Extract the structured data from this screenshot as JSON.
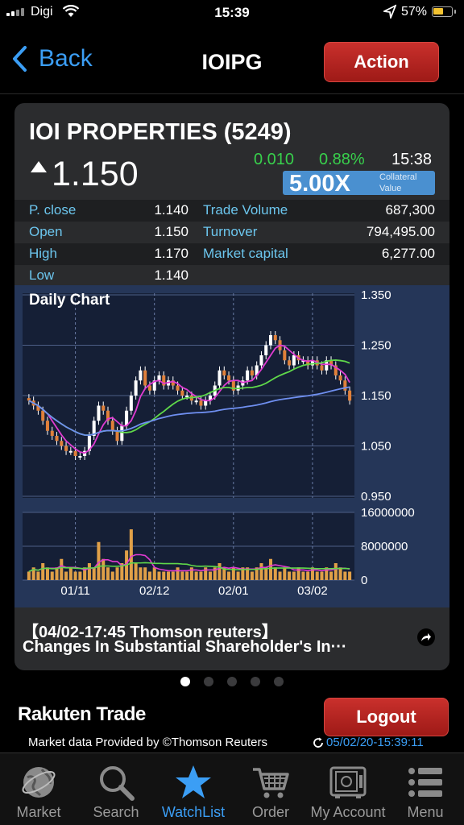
{
  "status": {
    "carrier": "Digi",
    "time": "15:39",
    "battery": "57%"
  },
  "nav": {
    "back_label": "Back",
    "title": "IOIPG",
    "action_label": "Action"
  },
  "stock": {
    "name": "IOI PROPERTIES (5249)",
    "price": "1.150",
    "change": "0.010",
    "change_pct": "0.88%",
    "time": "15:38",
    "collateral_multiplier": "5.00X",
    "collateral_label_1": "Collateral",
    "collateral_label_2": "Value",
    "up_color": "#38d04c"
  },
  "quote": {
    "rows": [
      {
        "l1": "P. close",
        "v1": "1.140",
        "l2": "Trade Volume",
        "v2": "687,300"
      },
      {
        "l1": "Open",
        "v1": "1.150",
        "l2": "Turnover",
        "v2": "794,495.00"
      },
      {
        "l1": "High",
        "v1": "1.170",
        "l2": "Market capital",
        "v2": "6,277.00"
      },
      {
        "l1": "Low",
        "v1": "1.140",
        "l2": "",
        "v2": ""
      }
    ]
  },
  "chart_data": {
    "type": "candlestick",
    "title": "Daily Chart",
    "price_ticks": [
      "1.350",
      "1.250",
      "1.150",
      "1.050",
      "0.950"
    ],
    "price_range": [
      0.95,
      1.35
    ],
    "volume_ticks": [
      "16000000",
      "8000000",
      "0"
    ],
    "volume_range": [
      0,
      16000000
    ],
    "date_ticks": [
      "01/11",
      "02/12",
      "02/01",
      "03/02"
    ],
    "grid": true,
    "close": [
      1.14,
      1.13,
      1.12,
      1.1,
      1.08,
      1.07,
      1.06,
      1.05,
      1.04,
      1.04,
      1.03,
      1.03,
      1.04,
      1.07,
      1.1,
      1.13,
      1.12,
      1.1,
      1.08,
      1.06,
      1.09,
      1.12,
      1.15,
      1.18,
      1.2,
      1.17,
      1.16,
      1.18,
      1.19,
      1.17,
      1.18,
      1.17,
      1.16,
      1.15,
      1.15,
      1.14,
      1.14,
      1.13,
      1.14,
      1.15,
      1.17,
      1.2,
      1.19,
      1.18,
      1.16,
      1.17,
      1.18,
      1.2,
      1.19,
      1.21,
      1.23,
      1.25,
      1.27,
      1.26,
      1.24,
      1.22,
      1.21,
      1.23,
      1.22,
      1.22,
      1.21,
      1.22,
      1.21,
      1.2,
      1.22,
      1.21,
      1.19,
      1.18,
      1.16,
      1.14
    ],
    "volume": [
      2,
      3,
      2,
      4,
      3,
      2,
      3,
      5,
      2,
      3,
      2,
      2,
      3,
      4,
      3,
      9,
      5,
      3,
      2,
      3,
      4,
      7,
      12,
      4,
      3,
      3,
      2,
      3,
      2,
      2,
      2,
      2,
      3,
      2,
      2,
      3,
      2,
      2,
      3,
      2,
      3,
      4,
      3,
      2,
      3,
      2,
      3,
      3,
      2,
      3,
      4,
      3,
      5,
      3,
      2,
      3,
      2,
      2,
      3,
      2,
      2,
      3,
      2,
      2,
      3,
      2,
      4,
      3,
      2,
      2
    ],
    "volume_unit": 1000000,
    "volume_scale_label_note": "millions in volume array"
  },
  "news": {
    "headline": "【04/02-17:45 Thomson reuters】",
    "body": "Changes In Substantial Shareholder's In···"
  },
  "footer": {
    "brand": "Rakuten Trade",
    "logout_label": "Logout",
    "provided": "Market data Provided by ©Thomson Reuters",
    "timestamp": "05/02/20-15:39:11"
  },
  "tabs": [
    {
      "label": "Market",
      "icon": "globe-icon"
    },
    {
      "label": "Search",
      "icon": "magnifier-icon"
    },
    {
      "label": "WatchList",
      "icon": "star-icon",
      "active": true
    },
    {
      "label": "Order",
      "icon": "cart-icon"
    },
    {
      "label": "My Account",
      "icon": "safe-icon"
    },
    {
      "label": "Menu",
      "icon": "list-icon"
    }
  ],
  "colors": {
    "accent": "#3b9ef5",
    "button_red": "#b8231f",
    "chart_bg": "#253658",
    "candle_up": "#ffffff",
    "candle_down": "#e0803a"
  }
}
